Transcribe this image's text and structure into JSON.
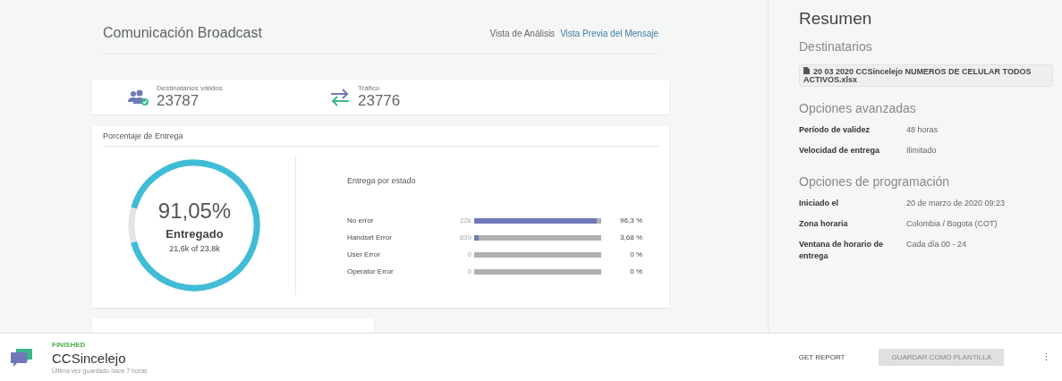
{
  "header": {
    "title": "Comunicación Broadcast",
    "links": [
      {
        "label": "Vista de Análisis",
        "selected": true
      },
      {
        "label": "Vista Previa del Mensaje",
        "selected": false
      }
    ]
  },
  "stats": [
    {
      "kind": "recipients",
      "label": "Destinatarios válidos",
      "value": "23787"
    },
    {
      "kind": "traffic",
      "label": "Tráfico",
      "value": "23776"
    }
  ],
  "delivery": {
    "title": "Porcentaje de Entrega",
    "percent": "91,05%",
    "caption": "Entregado",
    "count": "21,6k of 23,8k",
    "level": 0.9105,
    "status_title": "Entrega por estado",
    "rows": [
      {
        "name": "No error",
        "count": "22k",
        "level": 0.963,
        "percent": "96,3 %"
      },
      {
        "name": "Handset Error",
        "count": "839",
        "level": 0.0368,
        "percent": "3,68 %"
      },
      {
        "name": "User Error",
        "count": "0",
        "level": 0,
        "percent": "0 %"
      },
      {
        "name": "Operator Error",
        "count": "0",
        "level": 0,
        "percent": "0 %"
      }
    ]
  },
  "summary": {
    "title": "Resumen",
    "recipients_title": "Destinatarios",
    "file": "20 03 2020 CCSincelejo NUMEROS DE CELULAR TODOS ACTIVOS.xlsx",
    "advanced_title": "Opciones avanzadas",
    "advanced": [
      {
        "label": "Período de validez",
        "value": "48 horas"
      },
      {
        "label": "Velocidad de entrega",
        "value": "Ilimitado"
      }
    ],
    "schedule_title": "Opciones de programación",
    "schedule": [
      {
        "label": "Iniciado el",
        "value": "20 de marzo de 2020 09:23"
      },
      {
        "label": "Zona horaria",
        "value": "Colombia / Bogota (COT)"
      },
      {
        "label": "Ventana de horario de entrega",
        "value": "Cada día 00 - 24"
      }
    ]
  },
  "footer": {
    "status": "FINISHED",
    "name": "CCSincelejo",
    "saved": "Última vez guardado hace 7 horas",
    "report": "GET REPORT",
    "save": "GUARDAR COMO PLANTILLA",
    "save_disabled": true,
    "menu": "⋮"
  }
}
